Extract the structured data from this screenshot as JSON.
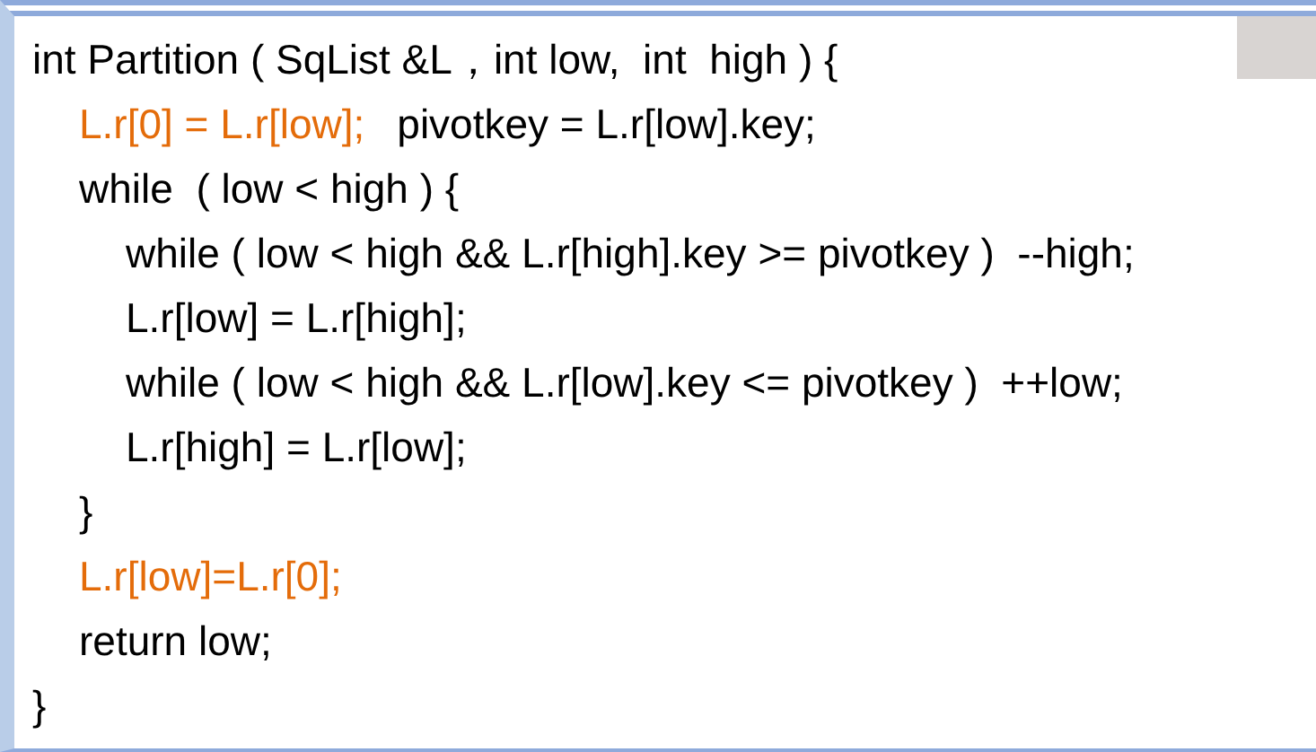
{
  "code": [
    {
      "segments": [
        {
          "text": "int Partition ( SqList &L，int low,  int  high ) {",
          "color": "#000000"
        }
      ],
      "children": [
        {
          "segments": [
            {
              "text": "L.r[0] = L.r[low];",
              "color": "#e46c0a"
            },
            {
              "text": "pivotkey = L.r[low].key;",
              "color": "#000000"
            }
          ]
        },
        {
          "segments": [
            {
              "text": "while  ( low < high ) {",
              "color": "#000000"
            }
          ],
          "children": [
            {
              "segments": [
                {
                  "text": "while ( low < high && L.r[high].key >= pivotkey )  --high;",
                  "color": "#000000"
                }
              ]
            },
            {
              "segments": [
                {
                  "text": "L.r[low] = L.r[high];",
                  "color": "#000000"
                }
              ]
            },
            {
              "segments": [
                {
                  "text": "while ( low < high && L.r[low].key <= pivotkey )  ++low;",
                  "color": "#000000"
                }
              ]
            },
            {
              "segments": [
                {
                  "text": "L.r[high] = L.r[low];",
                  "color": "#000000"
                }
              ]
            }
          ]
        },
        {
          "segments": [
            {
              "text": "}",
              "color": "#000000"
            }
          ]
        },
        {
          "segments": [
            {
              "text": "L.r[low]=L.r[0];",
              "color": "#e46c0a"
            }
          ]
        },
        {
          "segments": [
            {
              "text": "return low;",
              "color": "#000000"
            }
          ]
        }
      ]
    },
    {
      "segments": [
        {
          "text": "}",
          "color": "#000000"
        }
      ]
    }
  ]
}
